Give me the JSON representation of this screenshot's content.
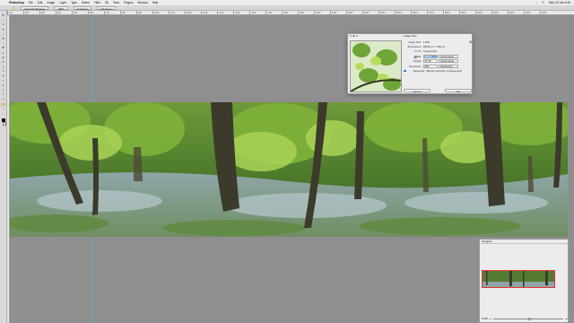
{
  "menubar": {
    "app_name": "Photoshop",
    "menus": [
      "File",
      "Edit",
      "Image",
      "Layer",
      "Type",
      "Select",
      "Filter",
      "3D",
      "View",
      "Plugins",
      "Window",
      "Help"
    ],
    "clock": "Wed 10 Jan 5:45"
  },
  "options": {
    "fields": [
      "Scroll All Windows",
      "100%",
      "Fit Screen",
      "Fill Screen"
    ]
  },
  "ruler": {
    "ticks": [
      "100",
      "200",
      "300",
      "400",
      "500",
      "600",
      "700",
      "800",
      "900",
      "1000",
      "1100",
      "1200",
      "1300",
      "1400",
      "1500",
      "1600",
      "1700",
      "1800",
      "1900",
      "2000",
      "2100",
      "2200",
      "2300",
      "2400",
      "2500",
      "2600",
      "2700",
      "2800",
      "2900",
      "3000",
      "3100",
      "3200",
      "3300",
      "3400"
    ]
  },
  "tools": [
    "move-icon",
    "marquee-icon",
    "lasso-icon",
    "quick-select-icon",
    "crop-icon",
    "frame-icon",
    "eyedropper-icon",
    "healing-icon",
    "brush-icon",
    "clone-stamp-icon",
    "history-brush-icon",
    "eraser-icon",
    "gradient-icon",
    "blur-icon",
    "dodge-icon",
    "pen-icon",
    "type-icon",
    "path-select-icon",
    "rectangle-icon",
    "hand-icon",
    "zoom-icon",
    "more-tools-icon"
  ],
  "tool_glyphs": [
    "✥",
    "⬚",
    "ʘ",
    "✎",
    "⌗",
    "⊠",
    "⁄",
    "✚",
    "✏",
    "⊕",
    "↺",
    "◻",
    "▭",
    "●",
    "◐",
    "✒",
    "T",
    "↖",
    "▢",
    "✋",
    "⌕",
    "…"
  ],
  "dialog": {
    "title": "Image Size",
    "rows": [
      {
        "label": "Image Size:",
        "value": "1.95G"
      },
      {
        "label": "Dimensions:",
        "value": "48638 px × 7993 px"
      },
      {
        "label": "Fit To:",
        "value": "Original Size"
      },
      {
        "label": "Width:",
        "value": "20000",
        "unit": "Centimeters"
      },
      {
        "label": "Height:",
        "value": "37.96",
        "unit": "Centimeters"
      },
      {
        "label": "Resolution:",
        "value": "300",
        "unit": "Pixels/Inch"
      },
      {
        "label": "Resample:",
        "value": "Bicubic smoother (enlargement)"
      }
    ],
    "cancel_label": "Cancel",
    "ok_label": "OK"
  },
  "navigator": {
    "title": "Navigator",
    "zoom": "8.33%"
  }
}
